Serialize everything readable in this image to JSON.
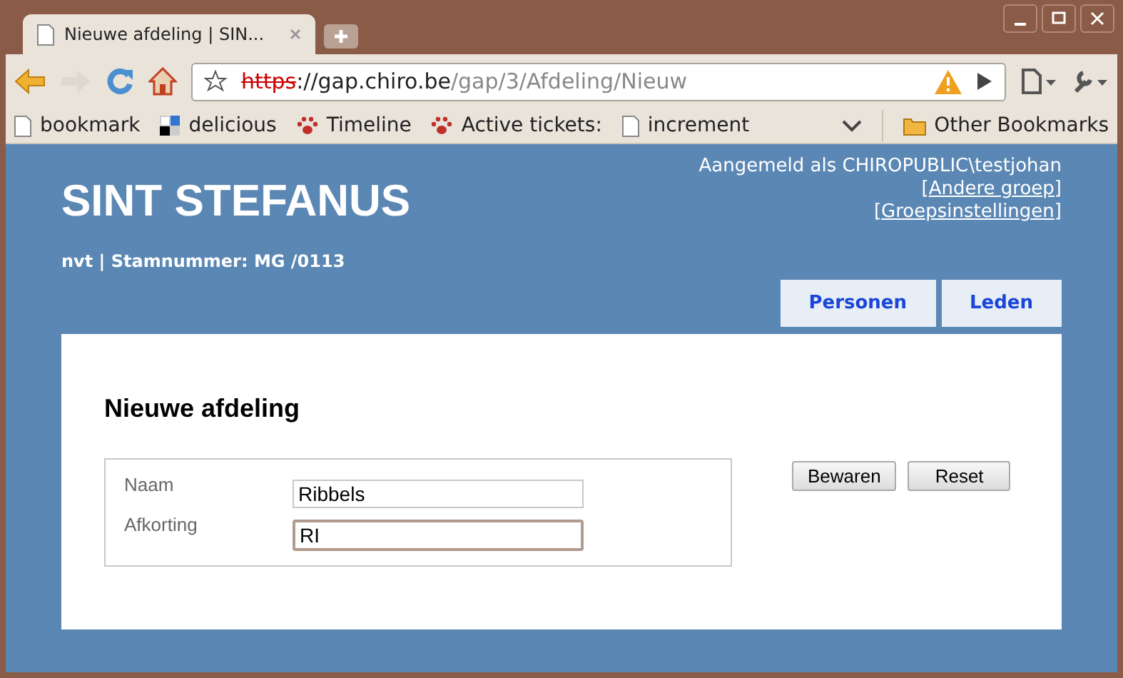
{
  "browser": {
    "tabs": [
      {
        "title": "Nieuwe afdeling | SIN...",
        "selected": true
      }
    ],
    "address": {
      "scheme": "https",
      "separator": "://",
      "host": "gap.chiro.be",
      "path": "/gap/3/Afdeling/Nieuw"
    },
    "bookmarks": [
      {
        "label": "bookmark",
        "kind": "page"
      },
      {
        "label": "delicious",
        "kind": "delicious"
      },
      {
        "label": "Timeline",
        "kind": "paw"
      },
      {
        "label": "Active tickets:",
        "kind": "paw"
      },
      {
        "label": "increment",
        "kind": "page"
      }
    ],
    "other_bookmarks": "Other Bookmarks"
  },
  "page": {
    "title": "SINT STEFANUS",
    "subtitle": "nvt | Stamnummer: MG /0113",
    "login": "Aangemeld als CHIROPUBLIC\\testjohan",
    "links": [
      {
        "open": "[",
        "label": "Andere groep",
        "close": "]"
      },
      {
        "open": "[",
        "label": "Groepsinstellingen",
        "close": "]"
      }
    ],
    "nav": [
      "Personen",
      "Leden"
    ],
    "heading": "Nieuwe afdeling",
    "fields": [
      {
        "label": "Naam",
        "value": "Ribbels",
        "focused": false
      },
      {
        "label": "Afkorting",
        "value": "RI",
        "focused": true
      }
    ],
    "buttons": [
      "Bewaren",
      "Reset"
    ]
  }
}
